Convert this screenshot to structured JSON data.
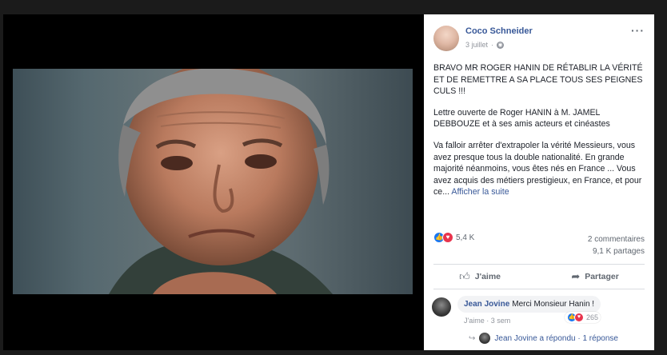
{
  "post": {
    "author": "Coco Schneider",
    "date": "3 juillet",
    "more_icon": "ellipsis-icon",
    "paragraphs": [
      "BRAVO MR ROGER HANIN DE RÉTABLIR LA VÉRITÉ ET DE REMETTRE A SA PLACE TOUS SES PEIGNES CULS !!!",
      "Lettre ouverte de Roger HANIN à M. JAMEL DEBBOUZE et à ses amis acteurs et cinéastes",
      "Va falloir arrêter d'extrapoler la vérité Messieurs, vous avez presque tous la double nationalité. En grande majorité néanmoins, vous êtes nés en France ... Vous avez acquis des métiers prestigieux, en France, et pour ce..."
    ],
    "see_more": "Afficher la suite",
    "reaction_count": "5,4 K",
    "comments_count": "2 commentaires",
    "shares_count": "9,1 K partages",
    "like_label": "J'aime",
    "share_label": "Partager"
  },
  "comment": {
    "author": "Jean Jovine",
    "text": "Merci Monsieur Hanin !",
    "like_label": "J'aime",
    "time": "3 sem",
    "reaction_count": "265"
  },
  "reply": {
    "text": "Jean Jovine a répondu · 1 réponse"
  },
  "colors": {
    "link": "#385898",
    "like": "#1877f2",
    "love": "#e8344d",
    "background": "#000000"
  }
}
